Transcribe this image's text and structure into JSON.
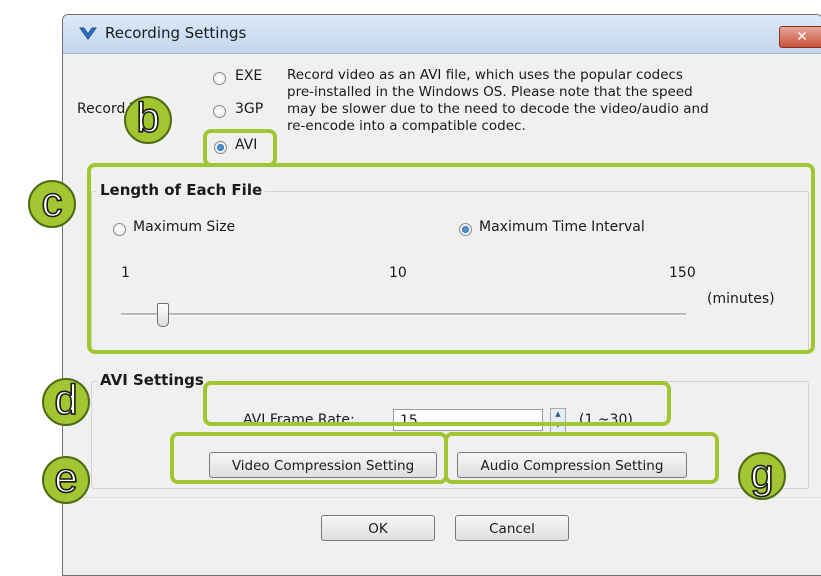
{
  "window": {
    "title": "Recording Settings",
    "close_label": "✕"
  },
  "record_type": {
    "label": "Record Type:",
    "options": [
      "EXE",
      "3GP",
      "AVI"
    ],
    "selected": "AVI",
    "description": [
      "Record video as an AVI file, which uses the popular codecs",
      "pre-installed in the Windows OS. Please note that the speed",
      "may be slower due to the need to decode the video/audio and",
      "re-encode into a compatible codec."
    ]
  },
  "length_group": {
    "title": "Length of Each File",
    "option_max_size": "Maximum Size",
    "option_max_time": "Maximum Time Interval",
    "selected": "Maximum Time Interval",
    "scale_min": "1",
    "scale_mid": "10",
    "scale_max": "150",
    "unit": "(minutes)",
    "slider_value": "3"
  },
  "avi_settings": {
    "title": "AVI Settings",
    "frame_rate_label": "AVI Frame Rate:",
    "frame_rate_value": "15",
    "frame_rate_range": "(1 ~30)",
    "video_button": "Video Compression Setting",
    "audio_button": "Audio Compression Setting"
  },
  "footer": {
    "ok": "OK",
    "cancel": "Cancel"
  },
  "annotations": {
    "b": "b",
    "c": "c",
    "d": "d",
    "e": "e",
    "g": "g",
    "accent": "#a2c532"
  },
  "icons": [
    "app-shield-icon",
    "close-icon",
    "spin-up-icon",
    "spin-down-icon"
  ]
}
